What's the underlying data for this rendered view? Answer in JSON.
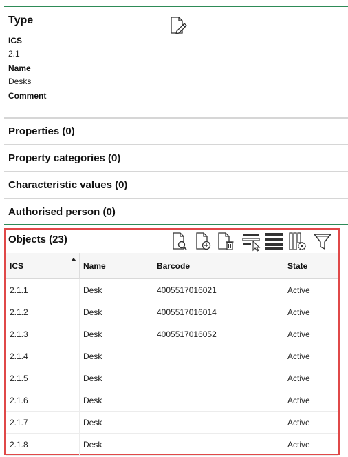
{
  "type_section": {
    "title": "Type",
    "fields": [
      {
        "label": "ICS",
        "value": "2.1"
      },
      {
        "label": "Name",
        "value": "Desks"
      },
      {
        "label": "Comment",
        "value": ""
      }
    ],
    "edit_icon": "edit-document-icon"
  },
  "sections": [
    {
      "label": "Properties (0)"
    },
    {
      "label": "Property categories (0)"
    },
    {
      "label": "Characteristic values (0)"
    },
    {
      "label": "Authorised person (0)"
    }
  ],
  "objects": {
    "title": "Objects (23)",
    "toolbar": [
      {
        "icon": "search-document-icon"
      },
      {
        "icon": "add-document-icon"
      },
      {
        "icon": "delete-document-icon"
      },
      {
        "icon": "select-rows-icon"
      },
      {
        "icon": "rows-view-icon"
      },
      {
        "icon": "column-settings-icon"
      },
      {
        "icon": "filter-icon"
      }
    ],
    "columns": [
      "ICS",
      "Name",
      "Barcode",
      "State"
    ],
    "sort": {
      "column": "ICS",
      "direction": "ascending"
    },
    "rows": [
      {
        "ics": "2.1.1",
        "name": "Desk",
        "barcode": "4005517016021",
        "state": "Active"
      },
      {
        "ics": "2.1.2",
        "name": "Desk",
        "barcode": "4005517016014",
        "state": "Active"
      },
      {
        "ics": "2.1.3",
        "name": "Desk",
        "barcode": "4005517016052",
        "state": "Active"
      },
      {
        "ics": "2.1.4",
        "name": "Desk",
        "barcode": "",
        "state": "Active"
      },
      {
        "ics": "2.1.5",
        "name": "Desk",
        "barcode": "",
        "state": "Active"
      },
      {
        "ics": "2.1.6",
        "name": "Desk",
        "barcode": "",
        "state": "Active"
      },
      {
        "ics": "2.1.7",
        "name": "Desk",
        "barcode": "",
        "state": "Active"
      },
      {
        "ics": "2.1.8",
        "name": "Desk",
        "barcode": "",
        "state": "Active"
      }
    ]
  },
  "colors": {
    "accent_line": "#2e8b57",
    "highlight_border": "#e04848"
  }
}
